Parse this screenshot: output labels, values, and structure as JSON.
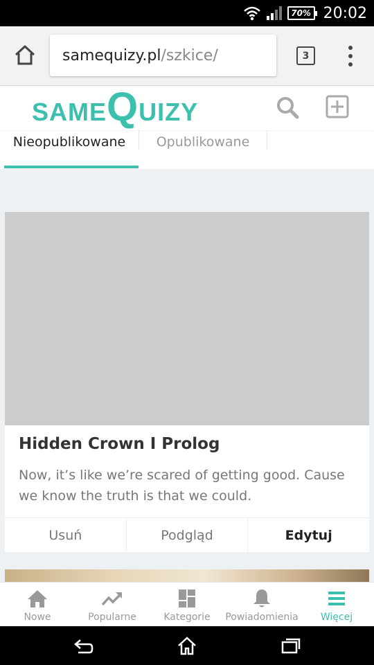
{
  "status_bar": {
    "battery": "70%",
    "time": "20:02"
  },
  "browser": {
    "url_host": "samequizy.pl",
    "url_path": "/szkice/",
    "tab_count": "3"
  },
  "header": {
    "logo_same": "SAME",
    "logo_q": "Q",
    "logo_uizy": "UIZY"
  },
  "tabs": [
    {
      "label": "Nieopublikowane",
      "active": true
    },
    {
      "label": "Opublikowane",
      "active": false
    }
  ],
  "card": {
    "title": "Hidden Crown I Prolog",
    "description": "Now, it’s like we’re scared of getting good. Cause we know the truth is that we could.",
    "actions": {
      "delete": "Usuń",
      "preview": "Podgląd",
      "edit": "Edytuj"
    }
  },
  "bottom_nav": [
    {
      "label": "Nowe",
      "icon": "home-icon",
      "active": false
    },
    {
      "label": "Popularne",
      "icon": "trending-icon",
      "active": false
    },
    {
      "label": "Kategorie",
      "icon": "grid-icon",
      "active": false
    },
    {
      "label": "Powiadomienia",
      "icon": "bell-icon",
      "active": false
    },
    {
      "label": "Więcej",
      "icon": "hamburger-icon",
      "active": true
    }
  ],
  "colors": {
    "accent": "#3cbfad",
    "background": "#eef1f4",
    "placeholder_image": "#cccccc"
  }
}
